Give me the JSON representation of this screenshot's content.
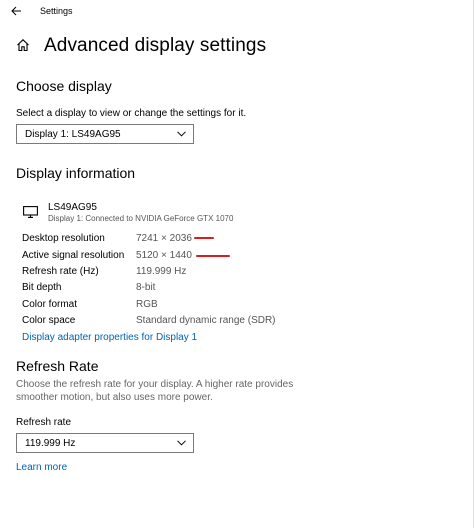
{
  "window": {
    "app_title": "Settings"
  },
  "header": {
    "title": "Advanced display settings"
  },
  "choose_display": {
    "title": "Choose display",
    "help": "Select a display to view or change the settings for it.",
    "selected": "Display 1: LS49AG95"
  },
  "display_info": {
    "title": "Display information",
    "monitor_name": "LS49AG95",
    "monitor_sub": "Display 1: Connected to NVIDIA GeForce GTX 1070",
    "rows": [
      {
        "label": "Desktop resolution",
        "value": "7241 × 2036"
      },
      {
        "label": "Active signal resolution",
        "value": "5120 × 1440"
      },
      {
        "label": "Refresh rate (Hz)",
        "value": "119.999 Hz"
      },
      {
        "label": "Bit depth",
        "value": "8-bit"
      },
      {
        "label": "Color format",
        "value": "RGB"
      },
      {
        "label": "Color space",
        "value": "Standard dynamic range (SDR)"
      }
    ],
    "adapter_link": "Display adapter properties for Display 1"
  },
  "refresh_rate": {
    "title": "Refresh Rate",
    "description": "Choose the refresh rate for your display. A higher rate provides smoother motion, but also uses more power.",
    "field_label": "Refresh rate",
    "selected": "119.999 Hz",
    "learn_more": "Learn more"
  },
  "colors": {
    "link": "#0063b1",
    "annotation": "#d81e1e",
    "secondary_text": "#555555"
  }
}
